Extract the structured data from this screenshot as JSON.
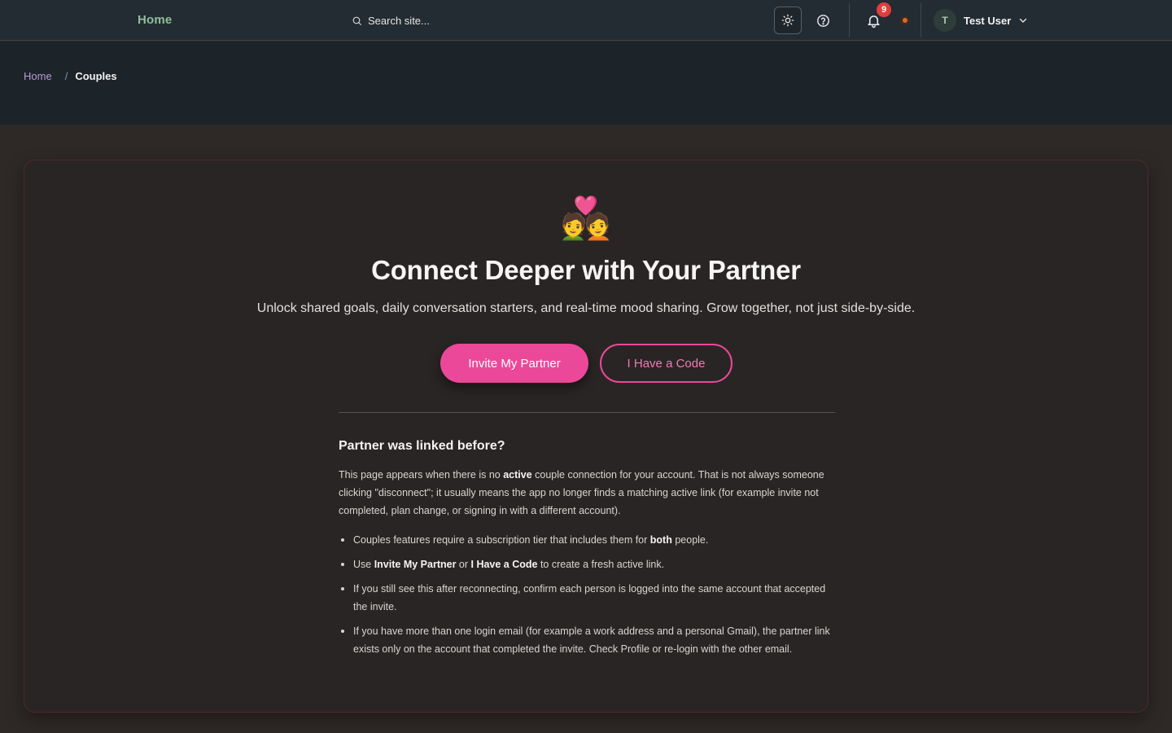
{
  "topbar": {
    "home_label": "Home",
    "search_placeholder": "Search site...",
    "notification_count": "9",
    "user_initial": "T",
    "user_name": "Test User"
  },
  "breadcrumb": {
    "home": "Home",
    "separator": "/",
    "current": "Couples"
  },
  "hero": {
    "emoji": "💑",
    "title": "Connect Deeper with Your Partner",
    "subtitle": "Unlock shared goals, daily conversation starters, and real-time mood sharing. Grow together, not just side-by-side.",
    "primary_button": "Invite My Partner",
    "secondary_button": "I Have a Code"
  },
  "info": {
    "title": "Partner was linked before?",
    "para_1": "This page appears when there is no ",
    "para_bold": "active",
    "para_2": " couple connection for your account. That is not always someone clicking \"disconnect\"; it usually means the app no longer finds a matching active link (for example invite not completed, plan change, or signing in with a different account).",
    "bullet_1_a": "Couples features require a subscription tier that includes them for ",
    "bullet_1_b": "both",
    "bullet_1_c": " people.",
    "bullet_2_a": "Use ",
    "bullet_2_b": "Invite My Partner",
    "bullet_2_c": " or ",
    "bullet_2_d": "I Have a Code",
    "bullet_2_e": " to create a fresh active link.",
    "bullet_3": "If you still see this after reconnecting, confirm each person is logged into the same account that accepted the invite.",
    "bullet_4": "If you have more than one login email (for example a work address and a personal Gmail), the partner link exists only on the account that completed the invite. Check Profile or re-login with the other email."
  },
  "colors": {
    "accent": "#ec4899",
    "topbar_bg": "#232c33",
    "breadcrumb_bg": "#1c2329",
    "card_bg": "#292524",
    "badge": "#e23d3d"
  },
  "icons": {
    "search": "search-icon",
    "theme": "sun-icon",
    "help": "help-circle-icon",
    "bell": "bell-icon",
    "status": "status-dot-icon",
    "chevron": "chevron-down-icon"
  }
}
